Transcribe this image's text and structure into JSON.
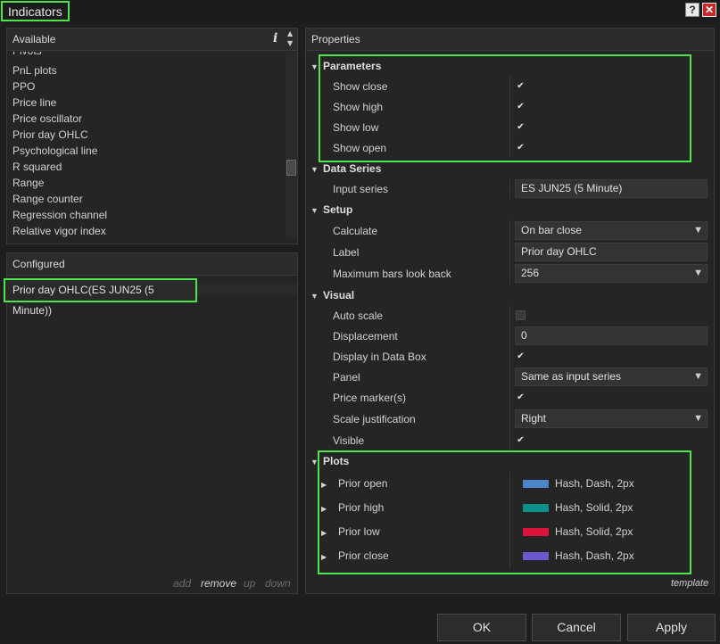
{
  "window": {
    "title": "Indicators",
    "help_glyph": "?",
    "close_glyph": "✕"
  },
  "available": {
    "header": "Available",
    "info_glyph": "i",
    "items": [
      "Pivots",
      "PnL plots",
      "PPO",
      "Price line",
      "Price oscillator",
      "Prior day OHLC",
      "Psychological line",
      "R squared",
      "Range",
      "Range counter",
      "Regression channel",
      "Relative vigor index"
    ]
  },
  "configured": {
    "header": "Configured",
    "items": [
      "Prior day OHLC(ES JUN25 (5 Minute))"
    ],
    "actions": {
      "add": "add",
      "remove": "remove",
      "up": "up",
      "down": "down"
    }
  },
  "properties": {
    "header": "Properties",
    "parameters": {
      "title": "Parameters",
      "rows": [
        {
          "label": "Show close",
          "checked": true
        },
        {
          "label": "Show high",
          "checked": true
        },
        {
          "label": "Show low",
          "checked": true
        },
        {
          "label": "Show open",
          "checked": true
        }
      ]
    },
    "data_series": {
      "title": "Data Series",
      "input_label": "Input series",
      "input_value": "ES JUN25 (5 Minute)"
    },
    "setup": {
      "title": "Setup",
      "calculate_label": "Calculate",
      "calculate_value": "On bar close",
      "label_label": "Label",
      "label_value": "Prior day OHLC",
      "maxbars_label": "Maximum bars look back",
      "maxbars_value": "256"
    },
    "visual": {
      "title": "Visual",
      "auto_scale_label": "Auto scale",
      "auto_scale": false,
      "displacement_label": "Displacement",
      "displacement_value": "0",
      "databox_label": "Display in Data Box",
      "databox": true,
      "panel_label": "Panel",
      "panel_value": "Same as input series",
      "price_marker_label": "Price marker(s)",
      "price_marker": true,
      "scale_just_label": "Scale justification",
      "scale_just_value": "Right",
      "visible_label": "Visible",
      "visible": true
    },
    "plots": {
      "title": "Plots",
      "rows": [
        {
          "label": "Prior open",
          "color": "#4a86c8",
          "desc": "Hash, Dash, 2px"
        },
        {
          "label": "Prior high",
          "color": "#0a8f8a",
          "desc": "Hash, Solid, 2px"
        },
        {
          "label": "Prior low",
          "color": "#dc143c",
          "desc": "Hash, Solid, 2px"
        },
        {
          "label": "Prior close",
          "color": "#6a5acd",
          "desc": "Hash, Dash, 2px"
        }
      ]
    },
    "template_link": "template"
  },
  "buttons": {
    "ok": "OK",
    "cancel": "Cancel",
    "apply": "Apply"
  },
  "icons": {
    "check": "✔",
    "expand_open": "▼",
    "expand_closed": "▶",
    "dropdown": "▼",
    "scroll_up": "▲",
    "scroll_down": "▼"
  }
}
